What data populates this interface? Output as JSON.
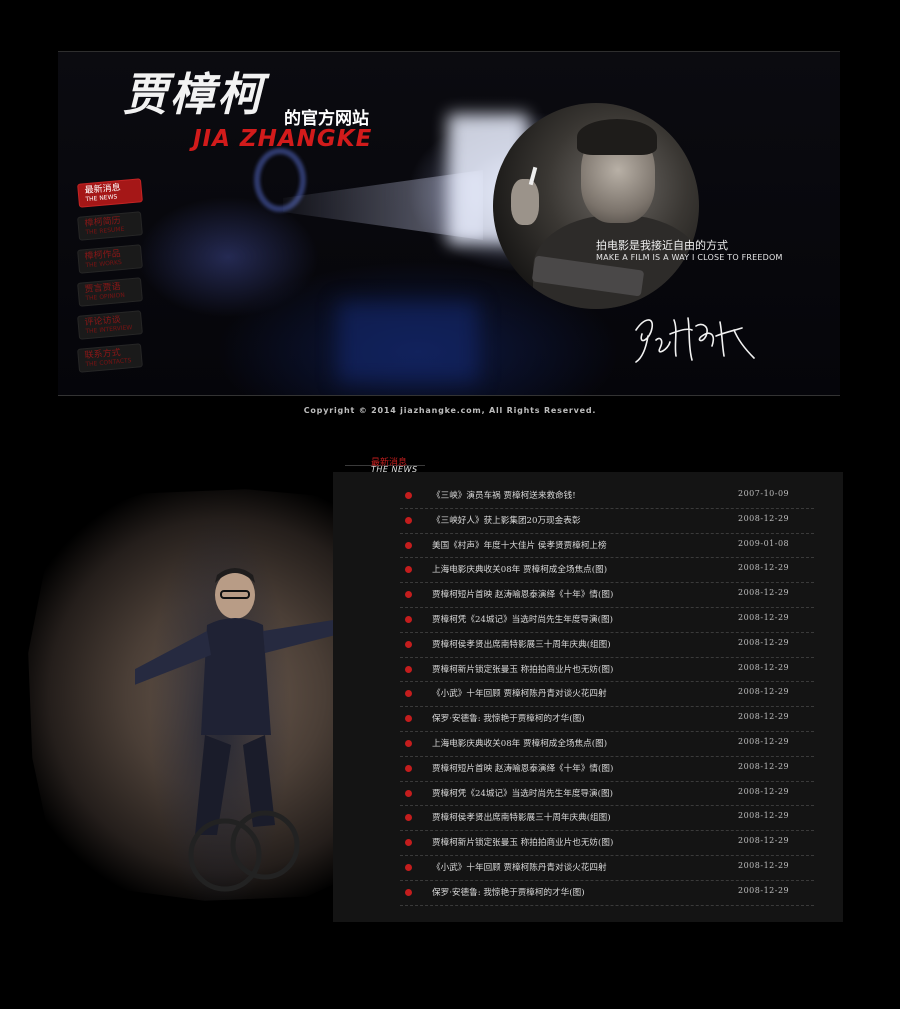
{
  "site": {
    "title_cn": "贾樟柯",
    "title_suffix": "的官方网站",
    "title_en": "JIA ZHANGKE"
  },
  "nav": {
    "items": [
      {
        "cn": "最新消息",
        "en": "THE NEWS",
        "active": true
      },
      {
        "cn": "樟柯简历",
        "en": "THE RESUME",
        "active": false
      },
      {
        "cn": "樟柯作品",
        "en": "THE WORKS",
        "active": false
      },
      {
        "cn": "贾言贾语",
        "en": "THE OPINION",
        "active": false
      },
      {
        "cn": "评论访谈",
        "en": "THE INTERVIEW",
        "active": false
      },
      {
        "cn": "联系方式",
        "en": "THE CONTACTS",
        "active": false
      }
    ]
  },
  "hero": {
    "quote_cn": "拍电影是我接近自由的方式",
    "quote_en": "MAKE A FILM IS A WAY I CLOSE TO FREEDOM"
  },
  "footer": {
    "copyright": "Copyright © 2014 jiazhangke.com, All Rights Reserved."
  },
  "news": {
    "title_cn": "最新消息",
    "title_en": "THE NEWS",
    "items": [
      {
        "title": "《三峡》演员车祸 贾樟柯送来救命钱!",
        "date": "2007-10-09"
      },
      {
        "title": "《三峡好人》获上影集团20万现金表彰",
        "date": "2008-12-29"
      },
      {
        "title": "美国《村声》年度十大佳片 侯孝贤贾樟柯上榜",
        "date": "2009-01-08"
      },
      {
        "title": "上海电影庆典收关08年 贾樟柯成全场焦点(图)",
        "date": "2008-12-29"
      },
      {
        "title": "贾樟柯短片首映 赵涛喻恩泰演绎《十年》情(图)",
        "date": "2008-12-29"
      },
      {
        "title": "贾樟柯凭《24城记》当选时尚先生年度导演(图)",
        "date": "2008-12-29"
      },
      {
        "title": "贾樟柯侯孝贤出席南特影展三十周年庆典(组图)",
        "date": "2008-12-29"
      },
      {
        "title": "贾樟柯新片锁定张曼玉 称拍拍商业片也无妨(图)",
        "date": "2008-12-29"
      },
      {
        "title": "《小武》十年回顾 贾樟柯陈丹青对谈火花四射",
        "date": "2008-12-29"
      },
      {
        "title": "保罗·安德鲁: 我惊艳于贾樟柯的才华(图)",
        "date": "2008-12-29"
      },
      {
        "title": "上海电影庆典收关08年 贾樟柯成全场焦点(图)",
        "date": "2008-12-29"
      },
      {
        "title": "贾樟柯短片首映 赵涛喻恩泰演绎《十年》情(图)",
        "date": "2008-12-29"
      },
      {
        "title": "贾樟柯凭《24城记》当选时尚先生年度导演(图)",
        "date": "2008-12-29"
      },
      {
        "title": "贾樟柯侯孝贤出席南特影展三十周年庆典(组图)",
        "date": "2008-12-29"
      },
      {
        "title": "贾樟柯新片锁定张曼玉 称拍拍商业片也无妨(图)",
        "date": "2008-12-29"
      },
      {
        "title": "《小武》十年回顾 贾樟柯陈丹青对谈火花四射",
        "date": "2008-12-29"
      },
      {
        "title": "保罗·安德鲁: 我惊艳于贾樟柯的才华(图)",
        "date": "2008-12-29"
      }
    ]
  },
  "colors": {
    "background": "#000000",
    "accent_red": "#c41d1d",
    "text": "#d8d8d8"
  }
}
